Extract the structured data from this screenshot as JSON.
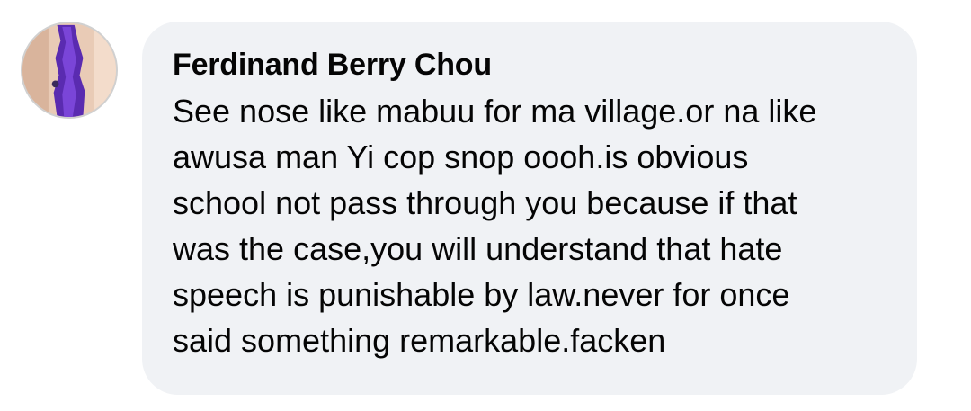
{
  "comment": {
    "author_name": "Ferdinand Berry Chou",
    "text": "See nose like mabuu for ma village.or na like\nawusa man Yi cop snop oooh.is obvious\nschool not pass through you because if that\nwas the case,you will understand that hate\nspeech is punishable by law.never for once\nsaid something remarkable.facken",
    "avatar_icon": "profile-photo-avatar",
    "bubble_color": "#f0f2f5",
    "text_color": "#050505"
  }
}
